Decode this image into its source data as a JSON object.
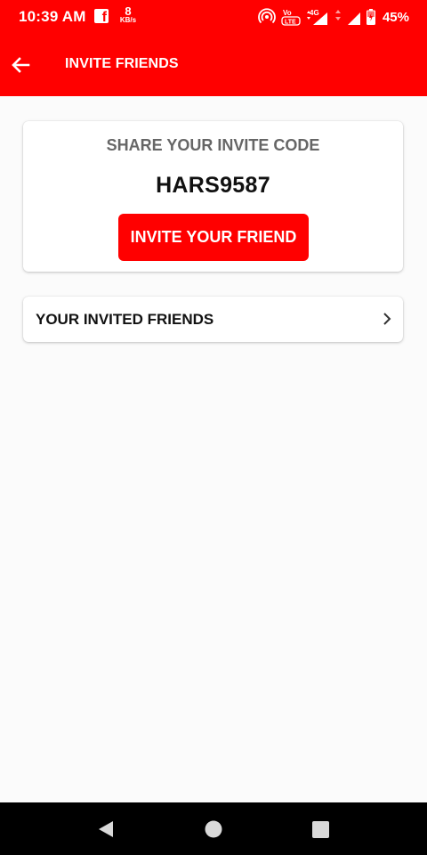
{
  "status_bar": {
    "time": "10:39 AM",
    "net_speed_value": "8",
    "net_speed_unit": "KB/s",
    "volte_label": "Vo LTE",
    "network_type": "4G",
    "battery": "45%"
  },
  "app_bar": {
    "title": "INVITE FRIENDS"
  },
  "share_card": {
    "title": "SHARE YOUR INVITE CODE",
    "code": "HARS9587",
    "button_label": "INVITE YOUR FRIEND"
  },
  "friends_card": {
    "label": "YOUR INVITED FRIENDS"
  },
  "colors": {
    "brand_red": "#ff0000",
    "background": "#fbfbfb",
    "card": "#ffffff"
  },
  "icons": {
    "back": "arrow-left-icon",
    "chevron": "chevron-right-icon",
    "nav_back": "triangle-back-icon",
    "nav_home": "circle-home-icon",
    "nav_recents": "square-recents-icon"
  }
}
